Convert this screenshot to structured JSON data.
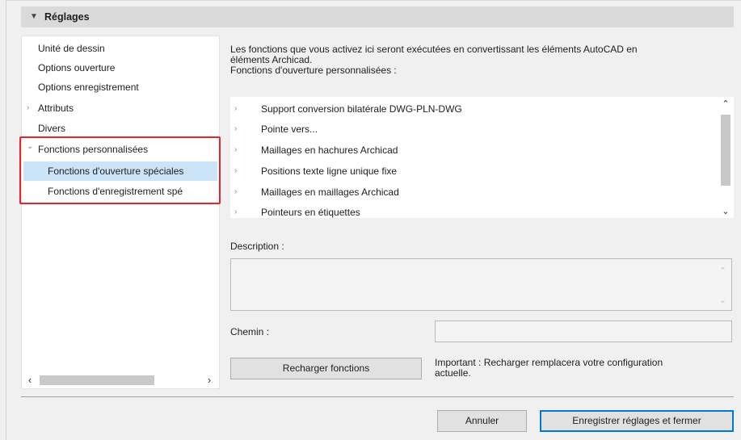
{
  "section": {
    "title": "Réglages",
    "collapse_icon": "caret-down-icon"
  },
  "tree": {
    "items": [
      {
        "label": "Unité de dessin",
        "chevron": ""
      },
      {
        "label": "Options ouverture",
        "chevron": ""
      },
      {
        "label": "Options enregistrement",
        "chevron": ""
      },
      {
        "label": "Attributs",
        "chevron": "›"
      },
      {
        "label": "Divers",
        "chevron": ""
      },
      {
        "label": "Fonctions personnalisées",
        "chevron": "⌄"
      },
      {
        "label": "Fonctions d'ouverture spéciales",
        "chevron": ""
      },
      {
        "label": "Fonctions d'enregistrement spé",
        "chevron": ""
      }
    ],
    "selected_index": 6,
    "scroll_left": "‹",
    "scroll_right": "›"
  },
  "intro": {
    "line1": "Les fonctions que vous activez ici seront exécutées en convertissant les éléments AutoCAD en",
    "line2": "éléments Archicad.",
    "line3": "Fonctions d'ouverture personnalisées :"
  },
  "functions": [
    "Support conversion bilatérale DWG-PLN-DWG",
    "Pointe vers...",
    "Maillages en hachures Archicad",
    "Positions texte ligne unique fixe",
    "Maillages en maillages Archicad",
    "Pointeurs en étiquettes"
  ],
  "scroll": {
    "up": "⌃",
    "down": "⌄"
  },
  "description": {
    "label": "Description :",
    "value": ""
  },
  "path": {
    "label": "Chemin :",
    "value": ""
  },
  "reload_button": "Recharger fonctions",
  "important_line1": "Important : Recharger remplacera votre configuration",
  "important_line2": "actuelle.",
  "cancel_button": "Annuler",
  "save_button": "Enregistrer réglages et fermer",
  "colors": {
    "selection": "#cce4f7",
    "highlight": "#e8262a",
    "accent": "#0078d7"
  }
}
